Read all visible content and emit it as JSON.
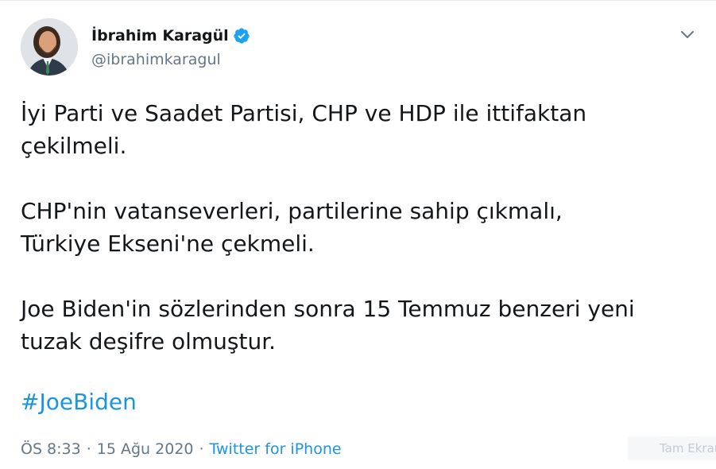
{
  "author": {
    "display_name": "İbrahim Karagül",
    "handle": "@ibrahimkaragul",
    "verified": true
  },
  "tweet": {
    "text": "İyi Parti ve Saadet Partisi, CHP ve HDP ile ittifaktan\nçekilmeli.\n\nCHP'nin vatanseverleri, partilerine sahip çıkmalı,\nTürkiye Ekseni'ne çekmeli.\n\nJoe Biden'in sözlerinden sonra 15 Temmuz benzeri yeni\ntuzak deşifre olmuştur.",
    "hashtag": "#JoeBiden"
  },
  "meta": {
    "time": "ÖS 8:33",
    "separator": "·",
    "date": "15 Ağu 2020",
    "source": "Twitter for iPhone"
  },
  "overlay": {
    "fullscreen_label": "Tam Ekran"
  },
  "colors": {
    "link": "#1b95e0",
    "secondary_text": "#657786",
    "verified": "#1da1f2"
  },
  "icons": {
    "verified": "verified-badge-icon",
    "menu": "chevron-down-icon"
  }
}
